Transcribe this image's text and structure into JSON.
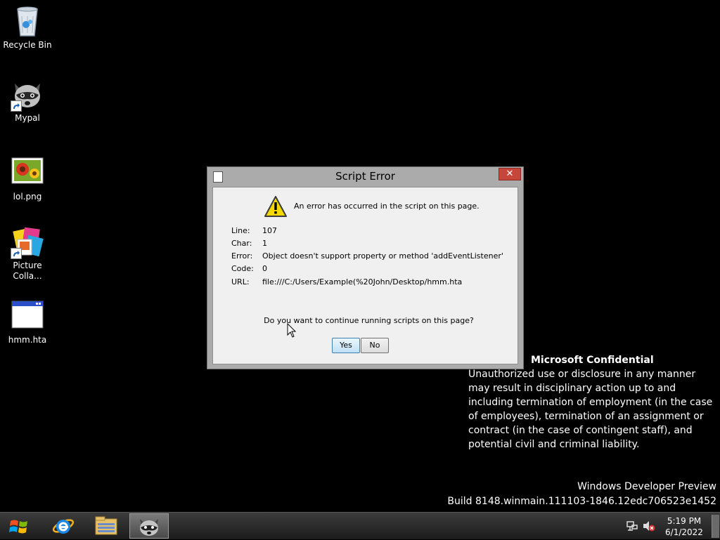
{
  "desktop": {
    "icons": [
      {
        "label": "Recycle Bin",
        "icon": "recycle-bin-icon"
      },
      {
        "label": "Mypal",
        "icon": "raccoon-browser-icon"
      },
      {
        "label": "lol.png",
        "icon": "image-file-icon"
      },
      {
        "label": "Picture Colla...",
        "icon": "picture-collage-icon"
      },
      {
        "label": "hmm.hta",
        "icon": "application-window-icon"
      }
    ],
    "watermark": {
      "title": "Microsoft Confidential",
      "body": "Unauthorized use or disclosure in any manner may result in disciplinary action up to and including termination of employment (in the case of employees), termination of an assignment or contract (in the case of contingent staff), and potential civil and criminal liability."
    },
    "build": {
      "line1": "Windows Developer Preview",
      "line2": "Build 8148.winmain.111103-1846.12edc706523e1452"
    }
  },
  "dialog": {
    "title": "Script Error",
    "close_label": "✕",
    "message": "An error has occurred in the script on this page.",
    "fields": [
      {
        "label": "Line:",
        "value": "107"
      },
      {
        "label": "Char:",
        "value": "1"
      },
      {
        "label": "Error:",
        "value": "Object doesn't support property or method 'addEventListener'"
      },
      {
        "label": "Code:",
        "value": "0"
      },
      {
        "label": "URL:",
        "value": "file:///C:/Users/Example(%20John/Desktop/hmm.hta"
      }
    ],
    "question": "Do you want to continue running scripts on this page?",
    "yes_label": "Yes",
    "no_label": "No"
  },
  "taskbar": {
    "buttons": [
      {
        "icon": "start-windows-icon"
      },
      {
        "icon": "internet-explorer-icon"
      },
      {
        "icon": "file-explorer-icon"
      },
      {
        "icon": "mypal-raccoon-icon",
        "active": true
      }
    ],
    "tray": {
      "network_icon": "network-icon",
      "volume_icon": "volume-muted-icon"
    },
    "clock": {
      "time": "5:19 PM",
      "date": "6/1/2022"
    }
  },
  "colors": {
    "desktop_bg": "#000000",
    "dialog_frame": "#ababab",
    "close_button": "#c7463b",
    "warning_yellow": "#f5d800",
    "yes_button_focus": "#3c7fb1"
  }
}
